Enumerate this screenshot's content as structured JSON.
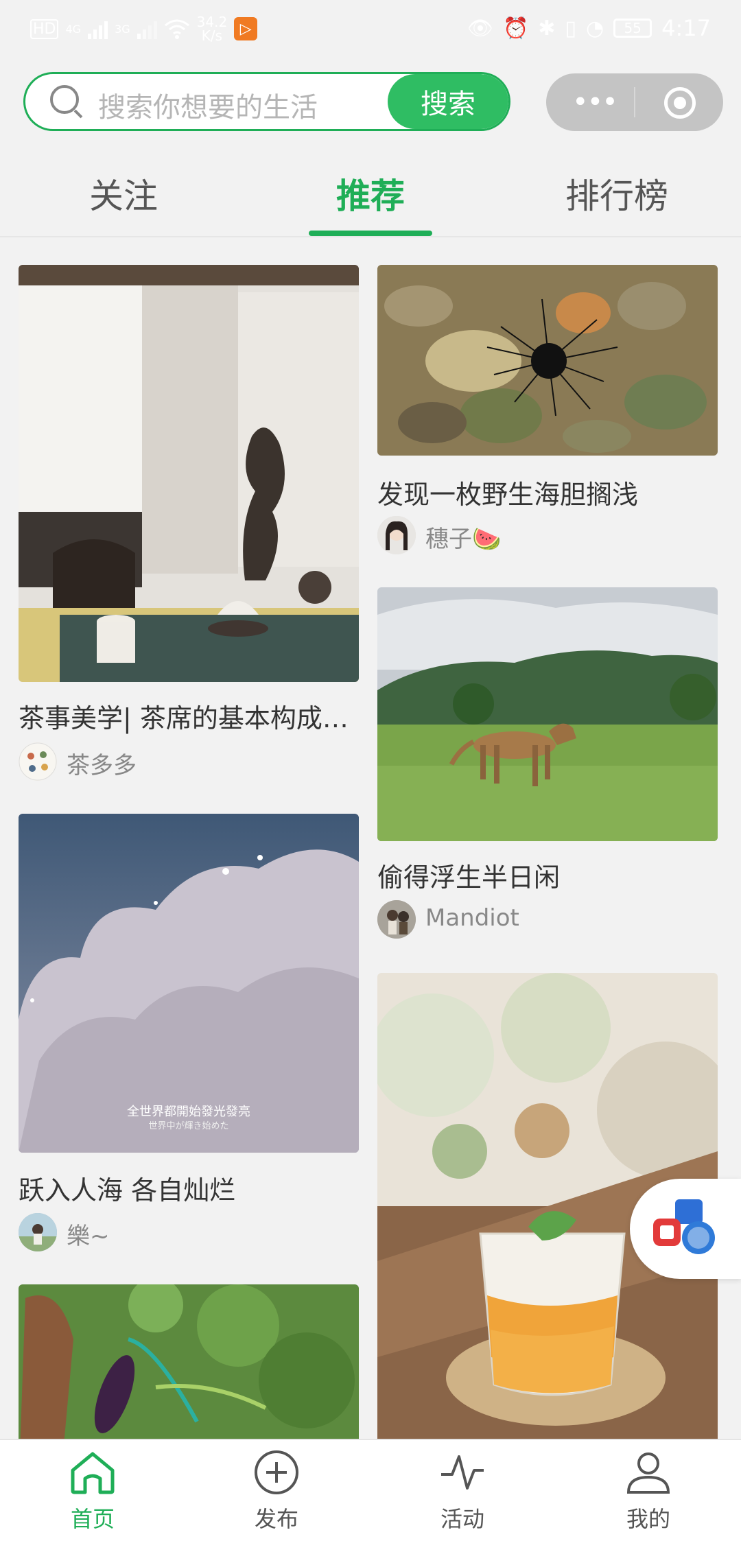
{
  "status_bar": {
    "left_badges": [
      "HD",
      "4G",
      "3G"
    ],
    "net_speed_value": "34.2",
    "net_speed_unit": "K/s",
    "time": "4:17",
    "battery": "55"
  },
  "search": {
    "placeholder": "搜索你想要的生活",
    "button_label": "搜索"
  },
  "tabs": [
    {
      "label": "关注",
      "active": false
    },
    {
      "label": "推荐",
      "active": true
    },
    {
      "label": "排行榜",
      "active": false
    }
  ],
  "feed": {
    "left": [
      {
        "title": "茶事美学| 茶席的基本构成…",
        "author": "茶多多"
      },
      {
        "title": "跃入人海 各自灿烂",
        "author": "樂~",
        "overlay_line1": "全世界都開始發光發亮",
        "overlay_line2": "世界中が輝き始めた"
      },
      {
        "title": "",
        "author": ""
      }
    ],
    "right": [
      {
        "title": "发现一枚野生海胆搁浅",
        "author": "穗子🍉"
      },
      {
        "title": "偷得浮生半日闲",
        "author": "Mandiot"
      },
      {
        "title": "",
        "author": ""
      }
    ]
  },
  "tabbar": [
    {
      "label": "首页",
      "icon": "home-icon",
      "active": true
    },
    {
      "label": "发布",
      "icon": "plus-circle-icon",
      "active": false
    },
    {
      "label": "活动",
      "icon": "activity-icon",
      "active": false
    },
    {
      "label": "我的",
      "icon": "user-icon",
      "active": false
    }
  ],
  "colors": {
    "accent": "#1fae57",
    "button": "#2fbd63",
    "background": "#f2f2f2"
  }
}
